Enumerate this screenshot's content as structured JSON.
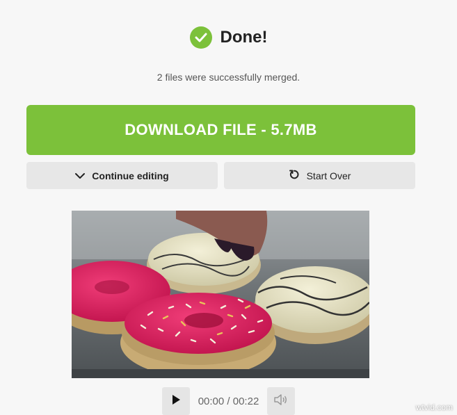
{
  "status": {
    "title": "Done!",
    "subtitle": "2 files were successfully merged.",
    "icon": "check-circle-icon",
    "color": "#7cc13a"
  },
  "actions": {
    "download_label": "DOWNLOAD FILE - 5.7MB",
    "continue_label": "Continue editing",
    "continue_icon": "chevron-down-icon",
    "start_over_label": "Start Over",
    "start_over_icon": "restart-icon"
  },
  "player": {
    "current_time": "00:00",
    "separator": "/",
    "duration": "00:22",
    "play_icon": "play-icon",
    "volume_icon": "volume-icon"
  },
  "watermark": "wtvid.com"
}
